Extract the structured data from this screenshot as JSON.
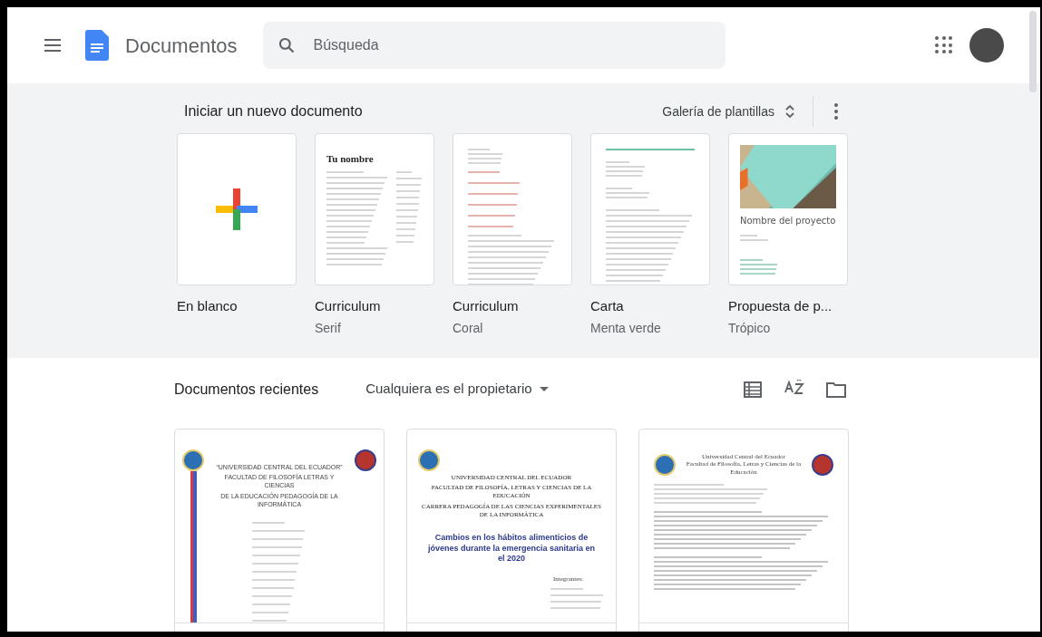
{
  "header": {
    "app_title": "Documentos",
    "search": {
      "placeholder": "Búsqueda"
    }
  },
  "new_document": {
    "title": "Iniciar un nuevo documento",
    "gallery_button": "Galería de plantillas",
    "templates": [
      {
        "kind": "blank",
        "name": "En blanco"
      },
      {
        "kind": "resume_serif",
        "name": "Curriculum",
        "subtitle": "Serif",
        "preview_title": "Tu nombre"
      },
      {
        "kind": "resume_coral",
        "name": "Curriculum",
        "subtitle": "Coral"
      },
      {
        "kind": "letter",
        "name": "Carta",
        "subtitle": "Menta verde"
      },
      {
        "kind": "proposal",
        "name": "Propuesta de p...",
        "subtitle": "Trópico",
        "preview_title": "Nombre del proyecto"
      }
    ]
  },
  "recent": {
    "title": "Documentos recientes",
    "owner_filter": "Cualquiera es el propietario",
    "documents": [
      {
        "kind": "cover_a",
        "headings": [
          "“UNIVERSIDAD CENTRAL DEL ECUADOR”",
          "FACULTAD DE FILOSOFÍA LETRAS Y CIENCIAS",
          "DE LA EDUCACIÓN PEDAGOGÍA DE LA INFORMÁTICA"
        ]
      },
      {
        "kind": "cover_b",
        "headings": [
          "UNIVERSIDAD CENTRAL DEL ECUADOR",
          "FACULTAD DE FILOSOFÍA, LETRAS Y CIENCIAS DE LA EDUCACIÓN",
          "CARRERA PEDAGOGÍA DE LAS CIENCIAS EXPERIMENTALES DE LA INFORMÁTICA"
        ],
        "title": "Cambios en los hábitos alimenticios de jóvenes durante la emergencia sanitaria en el 2020",
        "members_label": "Integrantes:"
      },
      {
        "kind": "essay",
        "headings": [
          "Universidad Central del Ecuador",
          "Facultad de Filosofía, Letras y Ciencias de la Educación"
        ]
      }
    ]
  }
}
